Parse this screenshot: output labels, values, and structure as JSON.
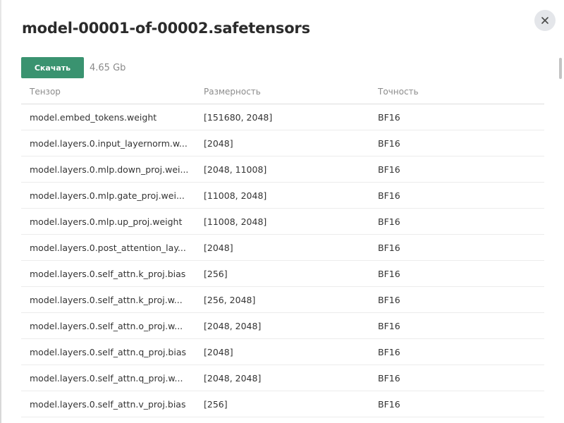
{
  "dialog": {
    "title": "model-00001-of-00002.safetensors",
    "download_label": "Скачать",
    "file_size": "4.65 Gb",
    "close_icon": "close-icon"
  },
  "table": {
    "headers": {
      "tensor": "Тензор",
      "shape": "Размерность",
      "dtype": "Точность"
    },
    "rows": [
      {
        "tensor": "model.embed_tokens.weight",
        "shape": "[151680, 2048]",
        "dtype": "BF16"
      },
      {
        "tensor": "model.layers.0.input_layernorm.w...",
        "shape": "[2048]",
        "dtype": "BF16"
      },
      {
        "tensor": "model.layers.0.mlp.down_proj.wei...",
        "shape": "[2048, 11008]",
        "dtype": "BF16"
      },
      {
        "tensor": "model.layers.0.mlp.gate_proj.wei...",
        "shape": "[11008, 2048]",
        "dtype": "BF16"
      },
      {
        "tensor": "model.layers.0.mlp.up_proj.weight",
        "shape": "[11008, 2048]",
        "dtype": "BF16"
      },
      {
        "tensor": "model.layers.0.post_attention_lay...",
        "shape": "[2048]",
        "dtype": "BF16"
      },
      {
        "tensor": "model.layers.0.self_attn.k_proj.bias",
        "shape": "[256]",
        "dtype": "BF16"
      },
      {
        "tensor": "model.layers.0.self_attn.k_proj.w...",
        "shape": "[256, 2048]",
        "dtype": "BF16"
      },
      {
        "tensor": "model.layers.0.self_attn.o_proj.w...",
        "shape": "[2048, 2048]",
        "dtype": "BF16"
      },
      {
        "tensor": "model.layers.0.self_attn.q_proj.bias",
        "shape": "[2048]",
        "dtype": "BF16"
      },
      {
        "tensor": "model.layers.0.self_attn.q_proj.w...",
        "shape": "[2048, 2048]",
        "dtype": "BF16"
      },
      {
        "tensor": "model.layers.0.self_attn.v_proj.bias",
        "shape": "[256]",
        "dtype": "BF16"
      }
    ]
  }
}
